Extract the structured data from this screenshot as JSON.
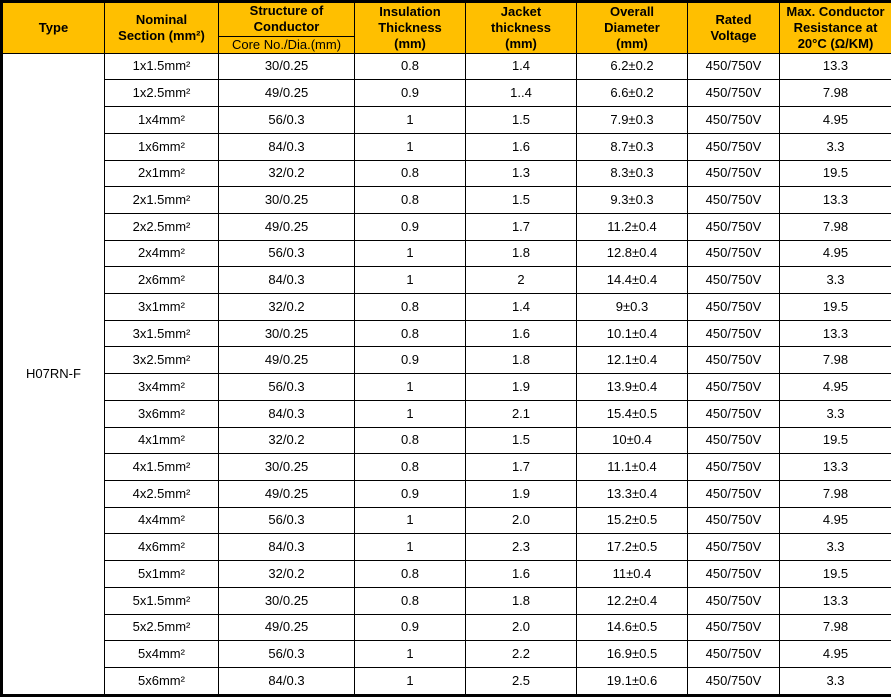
{
  "table": {
    "headers": {
      "type": "Type",
      "nominal_section": [
        "Nominal",
        "Section (mm²)"
      ],
      "structure_of_conductor": [
        "Structure of",
        "Conductor"
      ],
      "structure_sub": "Core No./Dia.(mm)",
      "insulation_thickness": [
        "Insulation",
        "Thickness",
        "(mm)"
      ],
      "jacket_thickness": [
        "Jacket",
        "thickness",
        "(mm)"
      ],
      "overall_diameter": [
        "Overall",
        "Diameter",
        "(mm)"
      ],
      "rated_voltage": [
        "Rated",
        "Voltage"
      ],
      "max_conductor_resistance": [
        "Max. Conductor",
        "Resistance at",
        "20°C (Ω/KM)"
      ]
    },
    "type_value": "H07RN-F",
    "rows": [
      {
        "section": "1x1.5mm²",
        "structure": "30/0.25",
        "insulation": "0.8",
        "jacket": "1.4",
        "diameter": "6.2±0.2",
        "voltage": "450/750V",
        "resistance": "13.3"
      },
      {
        "section": "1x2.5mm²",
        "structure": "49/0.25",
        "insulation": "0.9",
        "jacket": "1..4",
        "diameter": "6.6±0.2",
        "voltage": "450/750V",
        "resistance": "7.98"
      },
      {
        "section": "1x4mm²",
        "structure": "56/0.3",
        "insulation": "1",
        "jacket": "1.5",
        "diameter": "7.9±0.3",
        "voltage": "450/750V",
        "resistance": "4.95"
      },
      {
        "section": "1x6mm²",
        "structure": "84/0.3",
        "insulation": "1",
        "jacket": "1.6",
        "diameter": "8.7±0.3",
        "voltage": "450/750V",
        "resistance": "3.3"
      },
      {
        "section": "2x1mm²",
        "structure": "32/0.2",
        "insulation": "0.8",
        "jacket": "1.3",
        "diameter": "8.3±0.3",
        "voltage": "450/750V",
        "resistance": "19.5"
      },
      {
        "section": "2x1.5mm²",
        "structure": "30/0.25",
        "insulation": "0.8",
        "jacket": "1.5",
        "diameter": "9.3±0.3",
        "voltage": "450/750V",
        "resistance": "13.3"
      },
      {
        "section": "2x2.5mm²",
        "structure": "49/0.25",
        "insulation": "0.9",
        "jacket": "1.7",
        "diameter": "11.2±0.4",
        "voltage": "450/750V",
        "resistance": "7.98"
      },
      {
        "section": "2x4mm²",
        "structure": "56/0.3",
        "insulation": "1",
        "jacket": "1.8",
        "diameter": "12.8±0.4",
        "voltage": "450/750V",
        "resistance": "4.95"
      },
      {
        "section": "2x6mm²",
        "structure": "84/0.3",
        "insulation": "1",
        "jacket": "2",
        "diameter": "14.4±0.4",
        "voltage": "450/750V",
        "resistance": "3.3"
      },
      {
        "section": "3x1mm²",
        "structure": "32/0.2",
        "insulation": "0.8",
        "jacket": "1.4",
        "diameter": "9±0.3",
        "voltage": "450/750V",
        "resistance": "19.5"
      },
      {
        "section": "3x1.5mm²",
        "structure": "30/0.25",
        "insulation": "0.8",
        "jacket": "1.6",
        "diameter": "10.1±0.4",
        "voltage": "450/750V",
        "resistance": "13.3"
      },
      {
        "section": "3x2.5mm²",
        "structure": "49/0.25",
        "insulation": "0.9",
        "jacket": "1.8",
        "diameter": "12.1±0.4",
        "voltage": "450/750V",
        "resistance": "7.98"
      },
      {
        "section": "3x4mm²",
        "structure": "56/0.3",
        "insulation": "1",
        "jacket": "1.9",
        "diameter": "13.9±0.4",
        "voltage": "450/750V",
        "resistance": "4.95"
      },
      {
        "section": "3x6mm²",
        "structure": "84/0.3",
        "insulation": "1",
        "jacket": "2.1",
        "diameter": "15.4±0.5",
        "voltage": "450/750V",
        "resistance": "3.3"
      },
      {
        "section": "4x1mm²",
        "structure": "32/0.2",
        "insulation": "0.8",
        "jacket": "1.5",
        "diameter": "10±0.4",
        "voltage": "450/750V",
        "resistance": "19.5"
      },
      {
        "section": "4x1.5mm²",
        "structure": "30/0.25",
        "insulation": "0.8",
        "jacket": "1.7",
        "diameter": "11.1±0.4",
        "voltage": "450/750V",
        "resistance": "13.3"
      },
      {
        "section": "4x2.5mm²",
        "structure": "49/0.25",
        "insulation": "0.9",
        "jacket": "1.9",
        "diameter": "13.3±0.4",
        "voltage": "450/750V",
        "resistance": "7.98"
      },
      {
        "section": "4x4mm²",
        "structure": "56/0.3",
        "insulation": "1",
        "jacket": "2.0",
        "diameter": "15.2±0.5",
        "voltage": "450/750V",
        "resistance": "4.95"
      },
      {
        "section": "4x6mm²",
        "structure": "84/0.3",
        "insulation": "1",
        "jacket": "2.3",
        "diameter": "17.2±0.5",
        "voltage": "450/750V",
        "resistance": "3.3"
      },
      {
        "section": "5x1mm²",
        "structure": "32/0.2",
        "insulation": "0.8",
        "jacket": "1.6",
        "diameter": "11±0.4",
        "voltage": "450/750V",
        "resistance": "19.5"
      },
      {
        "section": "5x1.5mm²",
        "structure": "30/0.25",
        "insulation": "0.8",
        "jacket": "1.8",
        "diameter": "12.2±0.4",
        "voltage": "450/750V",
        "resistance": "13.3"
      },
      {
        "section": "5x2.5mm²",
        "structure": "49/0.25",
        "insulation": "0.9",
        "jacket": "2.0",
        "diameter": "14.6±0.5",
        "voltage": "450/750V",
        "resistance": "7.98"
      },
      {
        "section": "5x4mm²",
        "structure": "56/0.3",
        "insulation": "1",
        "jacket": "2.2",
        "diameter": "16.9±0.5",
        "voltage": "450/750V",
        "resistance": "4.95"
      },
      {
        "section": "5x6mm²",
        "structure": "84/0.3",
        "insulation": "1",
        "jacket": "2.5",
        "diameter": "19.1±0.6",
        "voltage": "450/750V",
        "resistance": "3.3"
      }
    ]
  },
  "colors": {
    "header_background": "#FFBF00",
    "border": "#000000",
    "text": "#000000"
  }
}
